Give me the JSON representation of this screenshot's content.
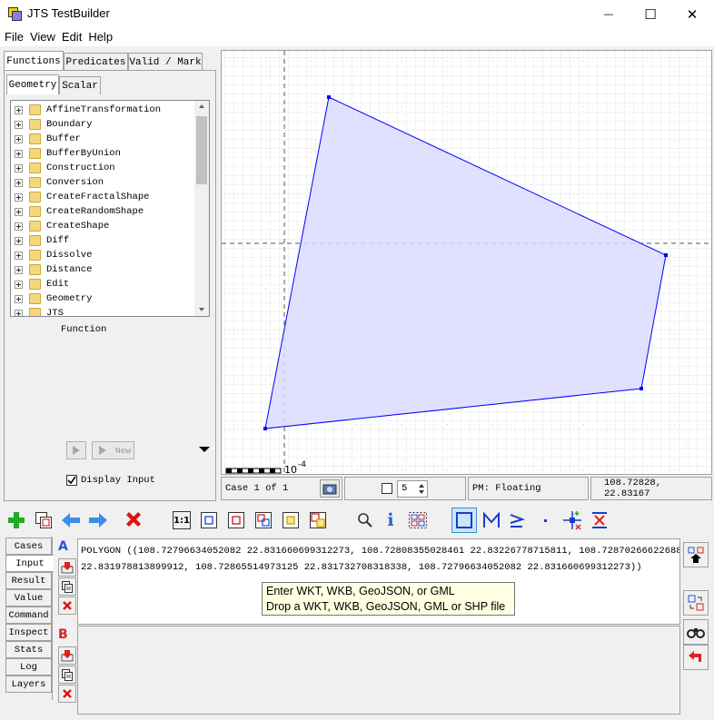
{
  "window": {
    "title": "JTS TestBuilder",
    "minimize_glyph": "—",
    "maximize_glyph": "☐",
    "close_glyph": "✕"
  },
  "menu": [
    "File",
    "View",
    "Edit",
    "Help"
  ],
  "left_panel": {
    "top_tabs": [
      "Functions",
      "Predicates",
      "Valid / Mark"
    ],
    "sub_tabs": [
      "Geometry",
      "Scalar"
    ],
    "tree_items": [
      "AffineTransformation",
      "Boundary",
      "Buffer",
      "BufferByUnion",
      "Construction",
      "Conversion",
      "CreateFractalShape",
      "CreateRandomShape",
      "CreateShape",
      "Diff",
      "Dissolve",
      "Distance",
      "Edit",
      "Geometry",
      "JTS"
    ],
    "function_label": "Function",
    "new_button": "New",
    "display_input_label": "Display Input",
    "display_input_checked": true
  },
  "canvas": {
    "scale_label": "10",
    "scale_exponent": "-4",
    "polygon_color": "#0000ff",
    "polygon_fill": "#e0e0ff"
  },
  "status": {
    "case_label": "Case 1 of 1",
    "spinner_value": "5",
    "precision_model": "PM: Floating",
    "coordinates": "108.72828, 22.83167"
  },
  "bottom_tabs": [
    "Cases",
    "Input",
    "Result",
    "Value",
    "Command",
    "Inspect",
    "Stats",
    "Log",
    "Layers"
  ],
  "active_bottom_tab": "Input",
  "input": {
    "label_a": "A",
    "label_b": "B",
    "wkt_line1": "POLYGON ((108.72796634052082 22.831660699312273, 108.72808355028461 22.83226778715811, 108.72870266622688",
    "wkt_line2": "22.831978813899912, 108.72865514973125 22.831732708318338, 108.72796634052082 22.831660699312273))",
    "tooltip_line1": "Enter WKT, WKB, GeoJSON, or GML",
    "tooltip_line2": "Drop a WKT, WKB, GeoJSON, GML or SHP file"
  },
  "toolbar": {
    "one_to_one_label": "1:1",
    "info_label": "i"
  }
}
